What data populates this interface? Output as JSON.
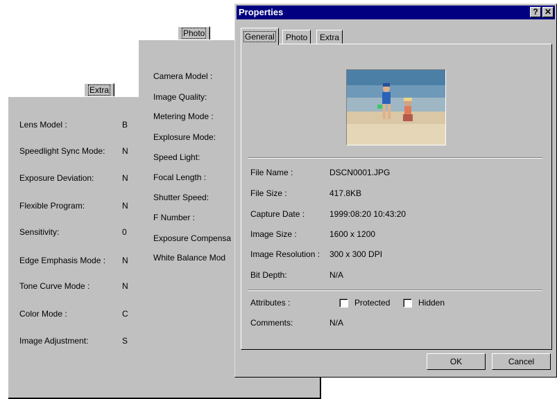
{
  "extra_panel": {
    "tab_label": "Extra",
    "rows": [
      {
        "label": "Lens Model :",
        "value": "B"
      },
      {
        "label": "Speedlight Sync Mode:",
        "value": "N"
      },
      {
        "label": "Exposure Deviation:",
        "value": "N"
      },
      {
        "label": "Flexible Program:",
        "value": "N"
      },
      {
        "label": "Sensitivity:",
        "value": "0"
      },
      {
        "label": "Edge Emphasis Mode :",
        "value": "N"
      },
      {
        "label": "Tone Curve Mode :",
        "value": "N"
      },
      {
        "label": "Color Mode :",
        "value": "C"
      },
      {
        "label": "Image Adjustment:",
        "value": "S"
      }
    ]
  },
  "photo_panel": {
    "tab_label": "Photo",
    "rows": [
      "Camera Model :",
      "Image Quality:",
      "Metering Mode :",
      "Explosure Mode:",
      "Speed Light:",
      "Focal Length :",
      "Shutter Speed:",
      "F Number :",
      "Exposure Compensa",
      "White Balance Mod"
    ]
  },
  "dialog": {
    "title": "Properties",
    "help_button": "?",
    "close_button": "✕",
    "tabs": [
      "General",
      "Photo",
      "Extra"
    ],
    "active_tab": "General",
    "fields": [
      {
        "label": "File Name :",
        "value": "DSCN0001.JPG"
      },
      {
        "label": "File Size :",
        "value": "417.8KB"
      },
      {
        "label": "Capture Date :",
        "value": "1999:08:20 10:43:20"
      },
      {
        "label": "Image Size :",
        "value": "1600 x 1200"
      },
      {
        "label": "Image Resolution :",
        "value": "300 x 300 DPI"
      },
      {
        "label": "Bit Depth:",
        "value": "N/A"
      }
    ],
    "attributes_label": "Attributes :",
    "protected_label": "Protected",
    "protected_checked": false,
    "hidden_label": "Hidden",
    "hidden_checked": false,
    "comments_label": "Comments:",
    "comments_value": "N/A",
    "ok_label": "OK",
    "cancel_label": "Cancel"
  }
}
